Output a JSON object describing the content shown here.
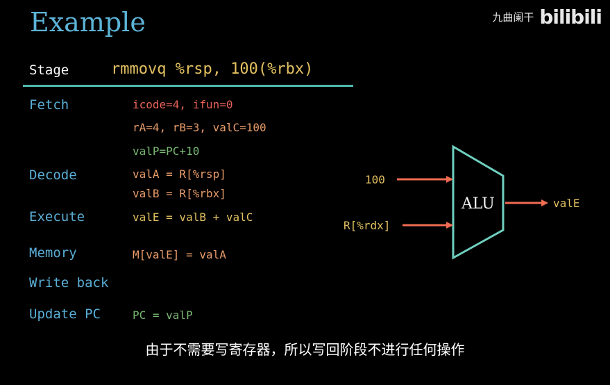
{
  "title": "Example",
  "brand": {
    "text": "九曲阑干",
    "logo": "bilibili"
  },
  "header": {
    "stage_label": "Stage",
    "instruction": "rmmovq %rsp, 100(%rbx)"
  },
  "stages": [
    {
      "name": "Fetch",
      "lines": [
        "icode=4, ifun=0",
        "rA=4, rB=3, valC=100",
        "valP=PC+10"
      ]
    },
    {
      "name": "Decode",
      "lines": [
        "valA = R[%rsp]",
        "valB = R[%rbx]"
      ]
    },
    {
      "name": "Execute",
      "lines": [
        "valE = valB + valC"
      ]
    },
    {
      "name": "Memory",
      "lines": [
        "M[valE] = valA"
      ]
    },
    {
      "name": "Write back",
      "lines": []
    },
    {
      "name": "Update PC",
      "lines": [
        "PC = valP"
      ]
    }
  ],
  "alu": {
    "label": "ALU",
    "input_a": "100",
    "input_b": "R[%rdx]",
    "output": "valE"
  },
  "colors": {
    "title": "#5cb3d6",
    "stage": "#5aaed6",
    "rule": "#4fb9ae",
    "alu_outline": "#6fd0c0",
    "arrow": "#ef6c52",
    "yellow": "#e2c060",
    "red": "#e8635a",
    "green": "#79b873",
    "orange": "#e89c6a"
  },
  "subtitle": "由于不需要写寄存器，所以写回阶段不进行任何操作"
}
